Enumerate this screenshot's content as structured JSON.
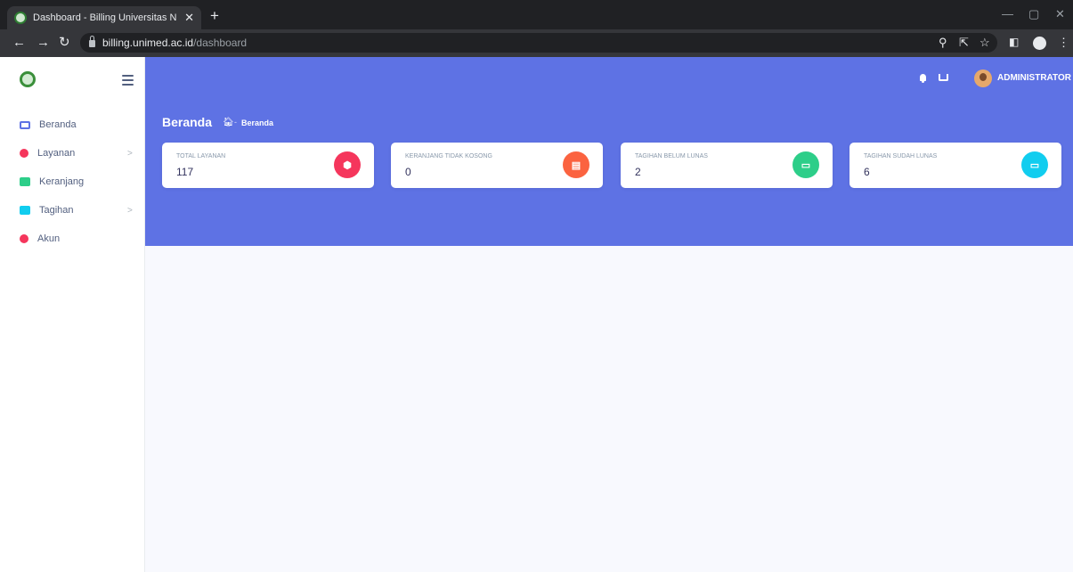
{
  "browser": {
    "tab_title": "Dashboard - Billing Universitas N",
    "tab_close": "✕",
    "new_tab": "+",
    "url_host": "billing.unimed.ac.id",
    "url_path": "/dashboard",
    "icons": [
      "search-icon",
      "share-icon",
      "star-icon",
      "sidepanel-icon",
      "profile-icon",
      "menu-icon"
    ]
  },
  "sidebar": {
    "items": [
      {
        "label": "Beranda",
        "icon": "monitor-icon",
        "color": "#5e72e4",
        "has_chevron": false
      },
      {
        "label": "Layanan",
        "icon": "box-icon",
        "color": "#f5365c",
        "has_chevron": true
      },
      {
        "label": "Keranjang",
        "icon": "cart-icon",
        "color": "#2dce89",
        "has_chevron": false
      },
      {
        "label": "Tagihan",
        "icon": "card-icon",
        "color": "#11cdef",
        "has_chevron": true
      },
      {
        "label": "Akun",
        "icon": "user-icon",
        "color": "#f5365c",
        "has_chevron": false
      }
    ],
    "chevron": ">"
  },
  "header": {
    "username": "ADMINISTRATOR",
    "page_title": "Beranda",
    "breadcrumb_sep": "-",
    "breadcrumb_label": "Beranda"
  },
  "cards": [
    {
      "label": "TOTAL LAYANAN",
      "value": "117",
      "icon": "box-icon",
      "color": "#f5365c"
    },
    {
      "label": "KERANJANG TIDAK KOSONG",
      "value": "0",
      "icon": "cart-icon",
      "color": "#fb6340"
    },
    {
      "label": "TAGIHAN BELUM LUNAS",
      "value": "2",
      "icon": "credit-card-icon",
      "color": "#2dce89"
    },
    {
      "label": "TAGIHAN SUDAH LUNAS",
      "value": "6",
      "icon": "credit-card-icon",
      "color": "#11cdef"
    }
  ]
}
